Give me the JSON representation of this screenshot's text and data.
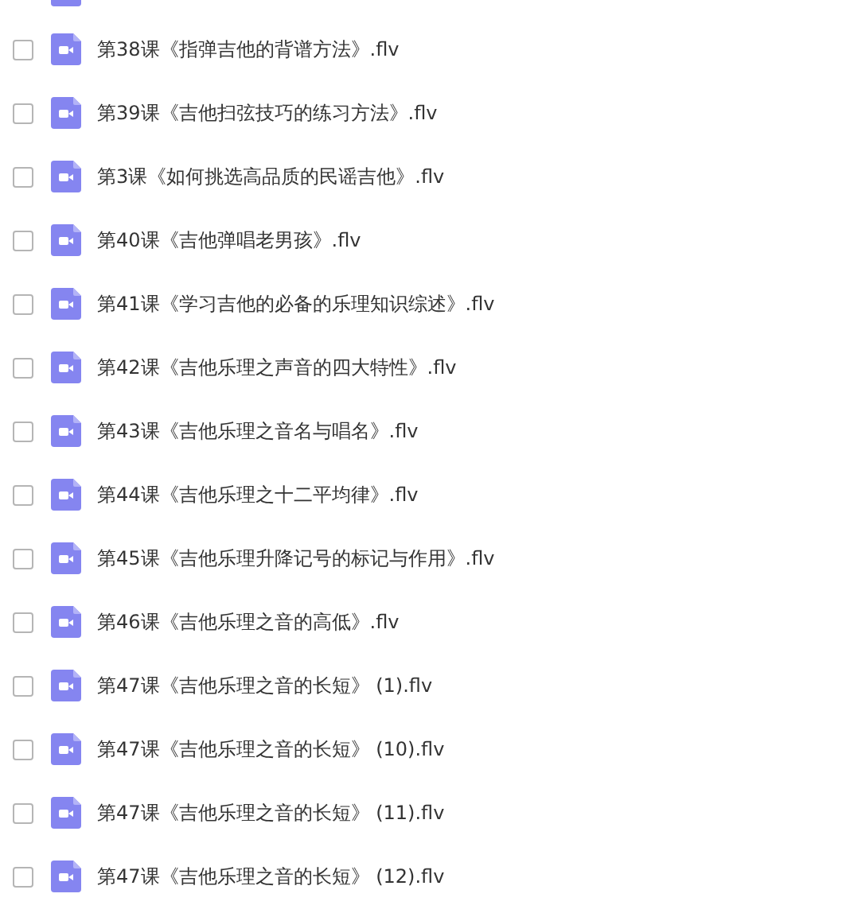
{
  "files": [
    {
      "name": "第38课《指弹吉他的背谱方法》.flv",
      "checked": false
    },
    {
      "name": "第39课《吉他扫弦技巧的练习方法》.flv",
      "checked": false
    },
    {
      "name": "第3课《如何挑选高品质的民谣吉他》.flv",
      "checked": false
    },
    {
      "name": "第40课《吉他弹唱老男孩》.flv",
      "checked": false
    },
    {
      "name": "第41课《学习吉他的必备的乐理知识综述》.flv",
      "checked": false
    },
    {
      "name": "第42课《吉他乐理之声音的四大特性》.flv",
      "checked": false
    },
    {
      "name": "第43课《吉他乐理之音名与唱名》.flv",
      "checked": false
    },
    {
      "name": "第44课《吉他乐理之十二平均律》.flv",
      "checked": false
    },
    {
      "name": "第45课《吉他乐理升降记号的标记与作用》.flv",
      "checked": false
    },
    {
      "name": "第46课《吉他乐理之音的高低》.flv",
      "checked": false
    },
    {
      "name": "第47课《吉他乐理之音的长短》 (1).flv",
      "checked": false
    },
    {
      "name": "第47课《吉他乐理之音的长短》 (10).flv",
      "checked": false
    },
    {
      "name": "第47课《吉他乐理之音的长短》 (11).flv",
      "checked": false
    },
    {
      "name": "第47课《吉他乐理之音的长短》 (12).flv",
      "checked": false
    }
  ]
}
